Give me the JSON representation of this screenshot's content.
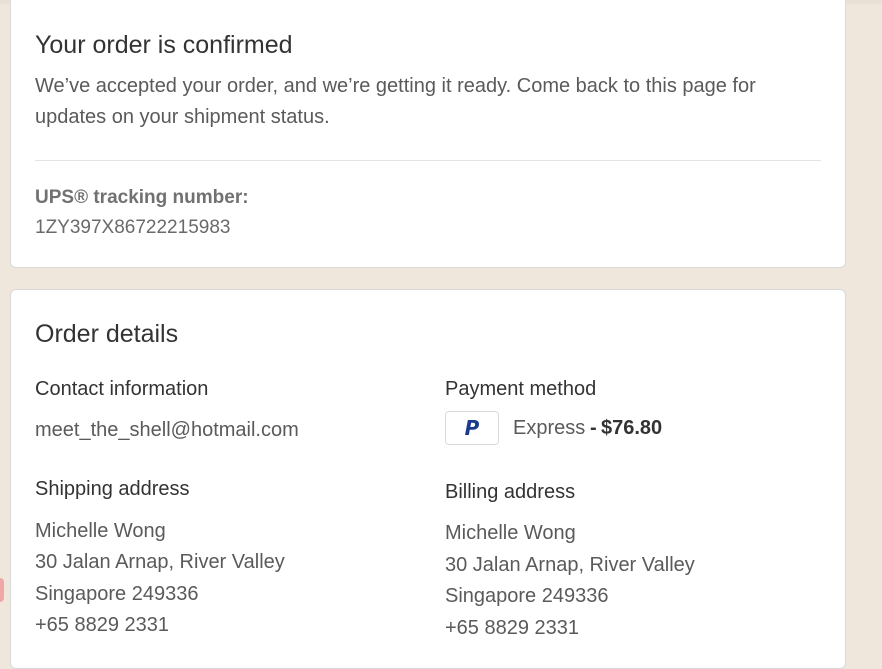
{
  "confirmation": {
    "title": "Your order is confirmed",
    "description": "We’ve accepted your order, and we’re getting it ready. Come back to this page for updates on your shipment status.",
    "tracking_label": "UPS® tracking number:",
    "tracking_number": "1ZY397X86722215983"
  },
  "order_details": {
    "title": "Order details",
    "contact": {
      "heading": "Contact information",
      "email": "meet_the_shell@hotmail.com"
    },
    "payment": {
      "heading": "Payment method",
      "icon": "paypal-icon",
      "method": "Express",
      "separator": "-",
      "amount": "$76.80"
    },
    "shipping": {
      "heading": "Shipping address",
      "lines": [
        "Michelle Wong",
        "30 Jalan Arnap, River Valley",
        "Singapore 249336",
        "+65 8829 2331"
      ]
    },
    "billing": {
      "heading": "Billing address",
      "lines": [
        "Michelle Wong",
        "30 Jalan Arnap, River Valley",
        "Singapore 249336",
        "+65 8829 2331"
      ]
    }
  },
  "colors": {
    "page_background": "#efe6dc",
    "card_background": "#ffffff",
    "paypal_blue": "#1a3a8f"
  }
}
